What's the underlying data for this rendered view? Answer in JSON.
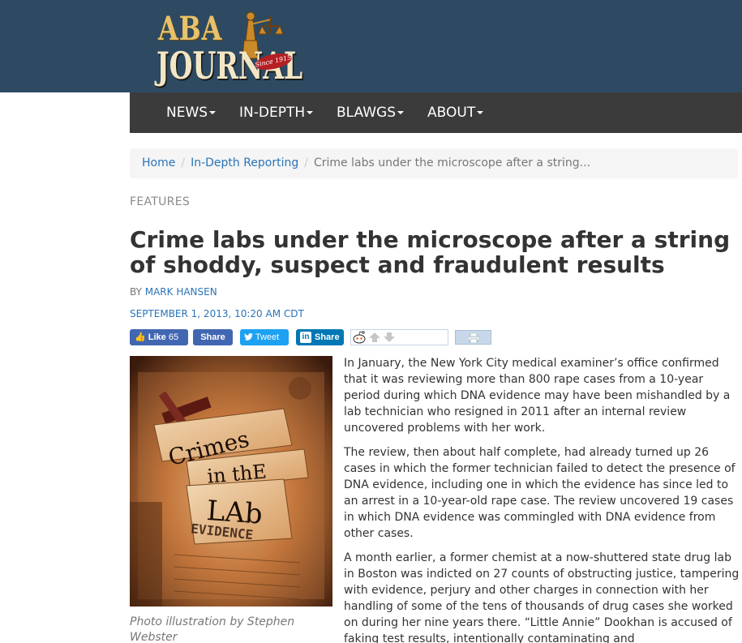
{
  "header": {
    "logo_line1": "ABA",
    "logo_line2": "JOURNAL",
    "logo_since": "Since 1915",
    "bg_color": "#2d4a62"
  },
  "nav": {
    "items": [
      {
        "label": "NEWS"
      },
      {
        "label": "IN-DEPTH"
      },
      {
        "label": "BLAWGS"
      },
      {
        "label": "ABOUT"
      }
    ]
  },
  "breadcrumb": {
    "home": "Home",
    "section": "In-Depth Reporting",
    "current": "Crime labs under the microscope after a string..."
  },
  "article": {
    "category": "FEATURES",
    "title": "Crime labs under the microscope after a string of shoddy, suspect and fraudulent results",
    "by_prefix": "BY",
    "author": "MARK HANSEN",
    "date": "SEPTEMBER 1, 2013, 10:20 AM CDT",
    "caption": "Photo illustration by Stephen Webster",
    "image_text": {
      "line1": "Crimes",
      "line2": "in thE",
      "line3": "LAb",
      "stamp": "EVIDENCE"
    },
    "paragraphs": [
      "In January, the New York City medical examiner’s office confirmed that it was reviewing more than 800 rape cases from a 10-year period during which DNA evidence may have been mishandled by a lab technician who resigned in 2011 after an internal review uncovered problems with her work.",
      "The review, then about half complete, had already turned up 26 cases in which the former technician failed to detect the presence of DNA evidence, including one in which the evidence has since led to an arrest in a 10-year-old rape case. The review uncovered 19 cases in which DNA evidence was commingled with DNA evidence from other cases.",
      "A month earlier, a former chemist at a now-shuttered state drug lab in Boston was indicted on 27 counts of obstructing justice, tampering with evidence, perjury and other charges in connection with her handling of some of the tens of thousands of drug cases she worked on during her nine years there. “Little Annie” Dookhan is accused of faking test results, intentionally contaminating and"
    ]
  },
  "share": {
    "fb_like": "Like",
    "fb_like_count": "65",
    "fb_share": "Share",
    "tweet": "Tweet",
    "linkedin_share": "Share",
    "linkedin_icon": "in"
  }
}
